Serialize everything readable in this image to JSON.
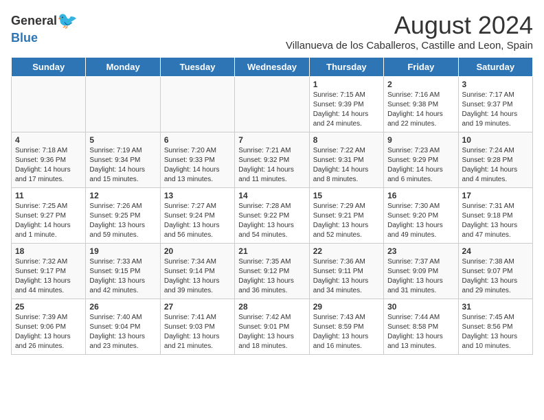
{
  "logo": {
    "general": "General",
    "blue": "Blue"
  },
  "title": "August 2024",
  "subtitle": "Villanueva de los Caballeros, Castille and Leon, Spain",
  "headers": [
    "Sunday",
    "Monday",
    "Tuesday",
    "Wednesday",
    "Thursday",
    "Friday",
    "Saturday"
  ],
  "weeks": [
    [
      {
        "day": "",
        "content": ""
      },
      {
        "day": "",
        "content": ""
      },
      {
        "day": "",
        "content": ""
      },
      {
        "day": "",
        "content": ""
      },
      {
        "day": "1",
        "content": "Sunrise: 7:15 AM\nSunset: 9:39 PM\nDaylight: 14 hours and 24 minutes."
      },
      {
        "day": "2",
        "content": "Sunrise: 7:16 AM\nSunset: 9:38 PM\nDaylight: 14 hours and 22 minutes."
      },
      {
        "day": "3",
        "content": "Sunrise: 7:17 AM\nSunset: 9:37 PM\nDaylight: 14 hours and 19 minutes."
      }
    ],
    [
      {
        "day": "4",
        "content": "Sunrise: 7:18 AM\nSunset: 9:36 PM\nDaylight: 14 hours and 17 minutes."
      },
      {
        "day": "5",
        "content": "Sunrise: 7:19 AM\nSunset: 9:34 PM\nDaylight: 14 hours and 15 minutes."
      },
      {
        "day": "6",
        "content": "Sunrise: 7:20 AM\nSunset: 9:33 PM\nDaylight: 14 hours and 13 minutes."
      },
      {
        "day": "7",
        "content": "Sunrise: 7:21 AM\nSunset: 9:32 PM\nDaylight: 14 hours and 11 minutes."
      },
      {
        "day": "8",
        "content": "Sunrise: 7:22 AM\nSunset: 9:31 PM\nDaylight: 14 hours and 8 minutes."
      },
      {
        "day": "9",
        "content": "Sunrise: 7:23 AM\nSunset: 9:29 PM\nDaylight: 14 hours and 6 minutes."
      },
      {
        "day": "10",
        "content": "Sunrise: 7:24 AM\nSunset: 9:28 PM\nDaylight: 14 hours and 4 minutes."
      }
    ],
    [
      {
        "day": "11",
        "content": "Sunrise: 7:25 AM\nSunset: 9:27 PM\nDaylight: 14 hours and 1 minute."
      },
      {
        "day": "12",
        "content": "Sunrise: 7:26 AM\nSunset: 9:25 PM\nDaylight: 13 hours and 59 minutes."
      },
      {
        "day": "13",
        "content": "Sunrise: 7:27 AM\nSunset: 9:24 PM\nDaylight: 13 hours and 56 minutes."
      },
      {
        "day": "14",
        "content": "Sunrise: 7:28 AM\nSunset: 9:22 PM\nDaylight: 13 hours and 54 minutes."
      },
      {
        "day": "15",
        "content": "Sunrise: 7:29 AM\nSunset: 9:21 PM\nDaylight: 13 hours and 52 minutes."
      },
      {
        "day": "16",
        "content": "Sunrise: 7:30 AM\nSunset: 9:20 PM\nDaylight: 13 hours and 49 minutes."
      },
      {
        "day": "17",
        "content": "Sunrise: 7:31 AM\nSunset: 9:18 PM\nDaylight: 13 hours and 47 minutes."
      }
    ],
    [
      {
        "day": "18",
        "content": "Sunrise: 7:32 AM\nSunset: 9:17 PM\nDaylight: 13 hours and 44 minutes."
      },
      {
        "day": "19",
        "content": "Sunrise: 7:33 AM\nSunset: 9:15 PM\nDaylight: 13 hours and 42 minutes."
      },
      {
        "day": "20",
        "content": "Sunrise: 7:34 AM\nSunset: 9:14 PM\nDaylight: 13 hours and 39 minutes."
      },
      {
        "day": "21",
        "content": "Sunrise: 7:35 AM\nSunset: 9:12 PM\nDaylight: 13 hours and 36 minutes."
      },
      {
        "day": "22",
        "content": "Sunrise: 7:36 AM\nSunset: 9:11 PM\nDaylight: 13 hours and 34 minutes."
      },
      {
        "day": "23",
        "content": "Sunrise: 7:37 AM\nSunset: 9:09 PM\nDaylight: 13 hours and 31 minutes."
      },
      {
        "day": "24",
        "content": "Sunrise: 7:38 AM\nSunset: 9:07 PM\nDaylight: 13 hours and 29 minutes."
      }
    ],
    [
      {
        "day": "25",
        "content": "Sunrise: 7:39 AM\nSunset: 9:06 PM\nDaylight: 13 hours and 26 minutes."
      },
      {
        "day": "26",
        "content": "Sunrise: 7:40 AM\nSunset: 9:04 PM\nDaylight: 13 hours and 23 minutes."
      },
      {
        "day": "27",
        "content": "Sunrise: 7:41 AM\nSunset: 9:03 PM\nDaylight: 13 hours and 21 minutes."
      },
      {
        "day": "28",
        "content": "Sunrise: 7:42 AM\nSunset: 9:01 PM\nDaylight: 13 hours and 18 minutes."
      },
      {
        "day": "29",
        "content": "Sunrise: 7:43 AM\nSunset: 8:59 PM\nDaylight: 13 hours and 16 minutes."
      },
      {
        "day": "30",
        "content": "Sunrise: 7:44 AM\nSunset: 8:58 PM\nDaylight: 13 hours and 13 minutes."
      },
      {
        "day": "31",
        "content": "Sunrise: 7:45 AM\nSunset: 8:56 PM\nDaylight: 13 hours and 10 minutes."
      }
    ]
  ]
}
